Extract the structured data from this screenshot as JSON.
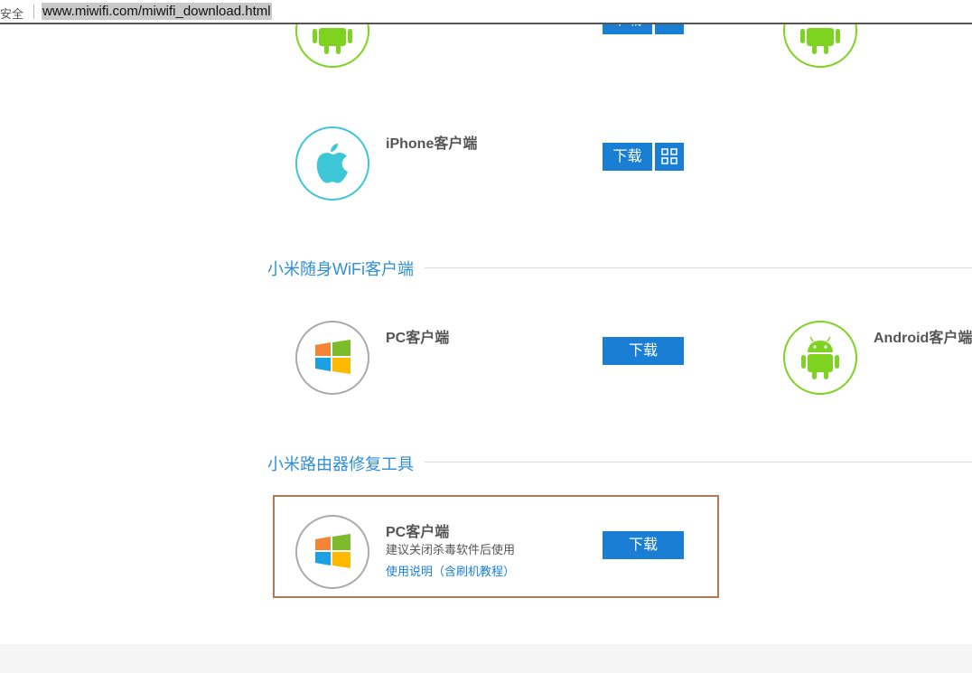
{
  "browser": {
    "security_label": "安全",
    "url": "www.miwifi.com/miwifi_download.html"
  },
  "colors": {
    "accent_blue": "#1a7fd4",
    "android_green": "#7ed321",
    "apple_teal": "#3cc6d6",
    "highlight_border": "#b07a5a"
  },
  "top_partial": {
    "download_label": "下载"
  },
  "iphone_client": {
    "title": "iPhone客户端",
    "download_label": "下载",
    "icon": "apple-icon",
    "qr_icon": "qr-code-icon"
  },
  "wifi_section": {
    "title": "小米随身WiFi客户端",
    "pc": {
      "title": "PC客户端",
      "download_label": "下载",
      "icon": "windows-icon"
    },
    "android": {
      "title": "Android客户端",
      "icon": "android-icon"
    }
  },
  "repair_section": {
    "title": "小米路由器修复工具",
    "pc": {
      "title": "PC客户端",
      "note": "建议关闭杀毒软件后使用",
      "help_link": "使用说明（含刷机教程）",
      "download_label": "下载",
      "icon": "windows-icon"
    }
  }
}
